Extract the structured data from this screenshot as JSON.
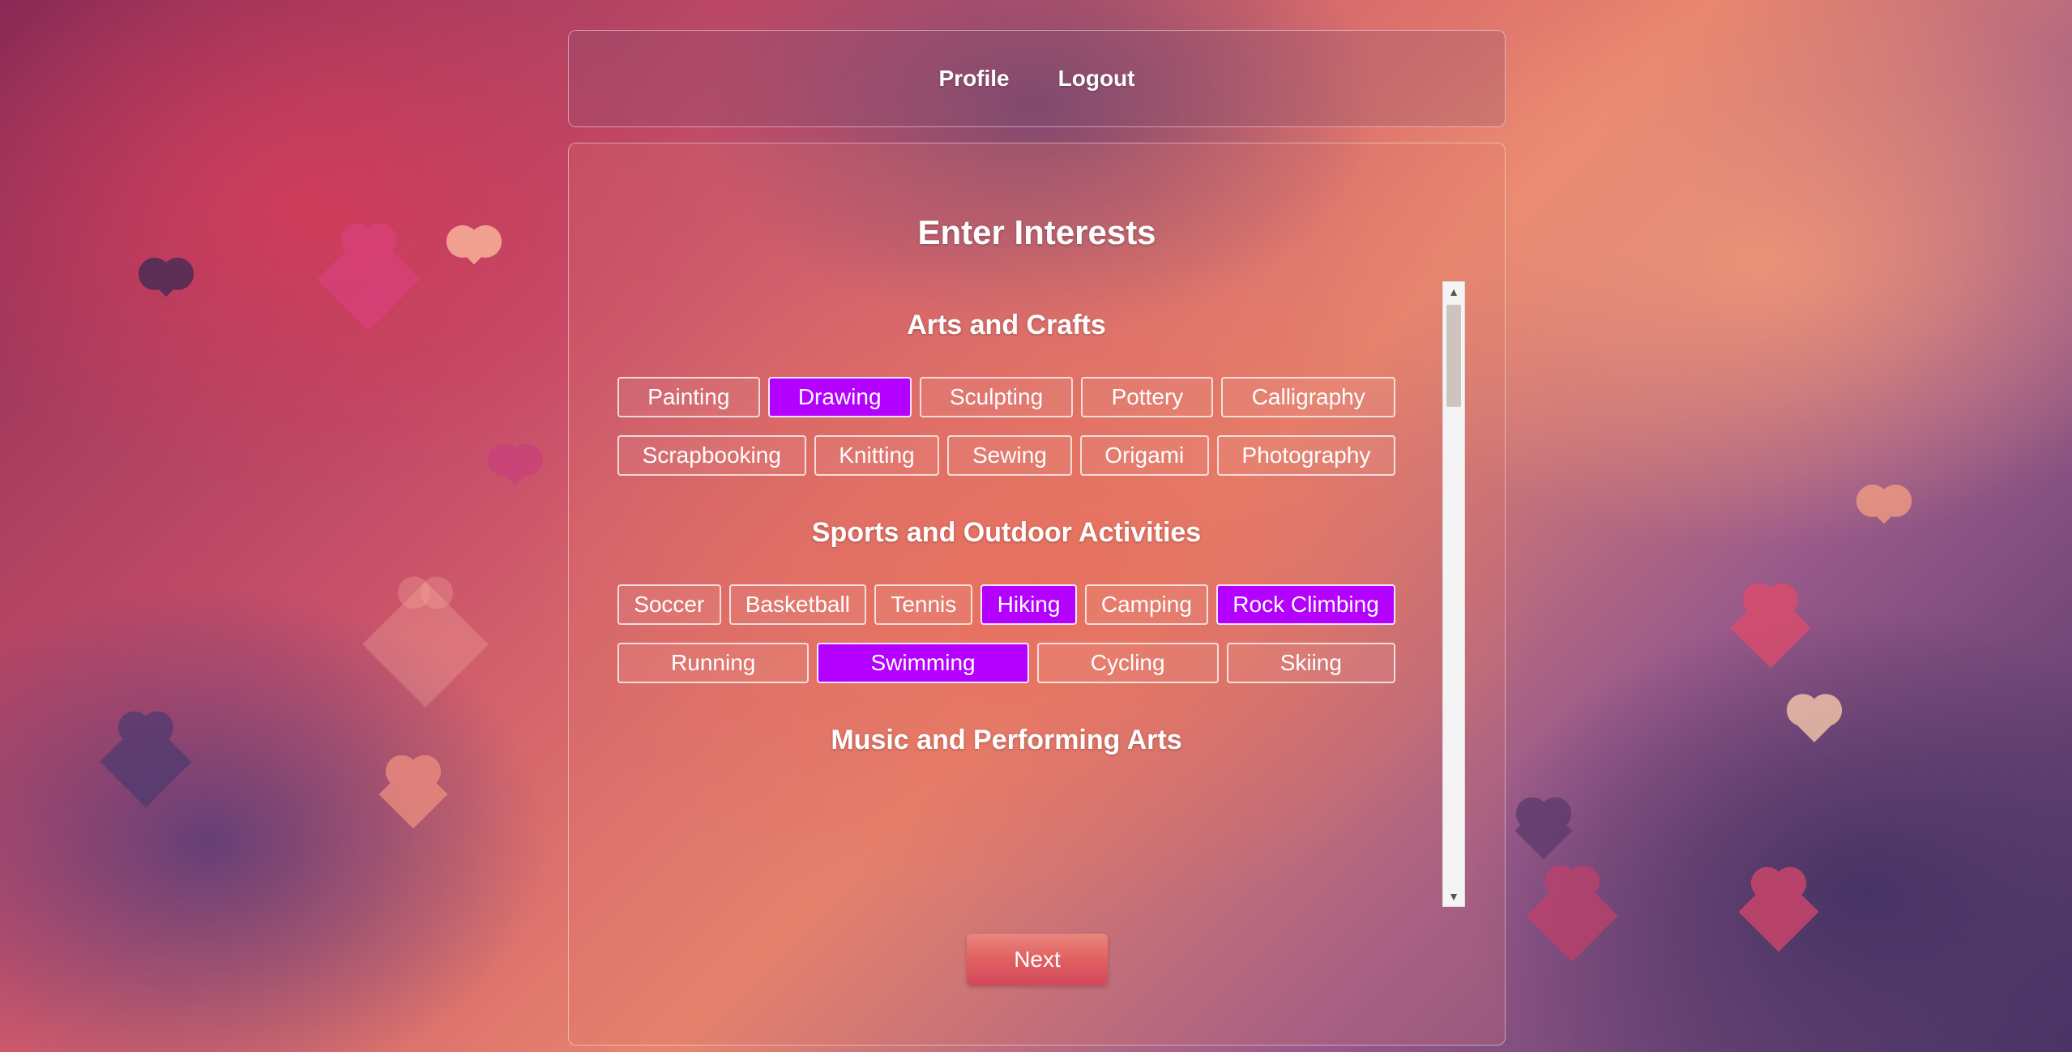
{
  "nav": {
    "profile_label": "Profile",
    "logout_label": "Logout"
  },
  "main": {
    "title": "Enter Interests",
    "next_label": "Next"
  },
  "categories": [
    {
      "title": "Arts and Crafts",
      "rows": [
        [
          {
            "label": "Painting",
            "selected": false
          },
          {
            "label": "Drawing",
            "selected": true
          },
          {
            "label": "Sculpting",
            "selected": false
          },
          {
            "label": "Pottery",
            "selected": false
          },
          {
            "label": "Calligraphy",
            "selected": false
          }
        ],
        [
          {
            "label": "Scrapbooking",
            "selected": false
          },
          {
            "label": "Knitting",
            "selected": false
          },
          {
            "label": "Sewing",
            "selected": false
          },
          {
            "label": "Origami",
            "selected": false
          },
          {
            "label": "Photography",
            "selected": false
          }
        ]
      ]
    },
    {
      "title": "Sports and Outdoor Activities",
      "rows": [
        [
          {
            "label": "Soccer",
            "selected": false
          },
          {
            "label": "Basketball",
            "selected": false
          },
          {
            "label": "Tennis",
            "selected": false
          },
          {
            "label": "Hiking",
            "selected": true
          },
          {
            "label": "Camping",
            "selected": false
          },
          {
            "label": "Rock Climbing",
            "selected": true
          }
        ],
        [
          {
            "label": "Running",
            "selected": false
          },
          {
            "label": "Swimming",
            "selected": true
          },
          {
            "label": "Cycling",
            "selected": false
          },
          {
            "label": "Skiing",
            "selected": false
          }
        ]
      ]
    },
    {
      "title": "Music and Performing Arts",
      "rows": []
    }
  ],
  "colors": {
    "selected_chip": "#b400ff",
    "next_button": "#e06060"
  }
}
